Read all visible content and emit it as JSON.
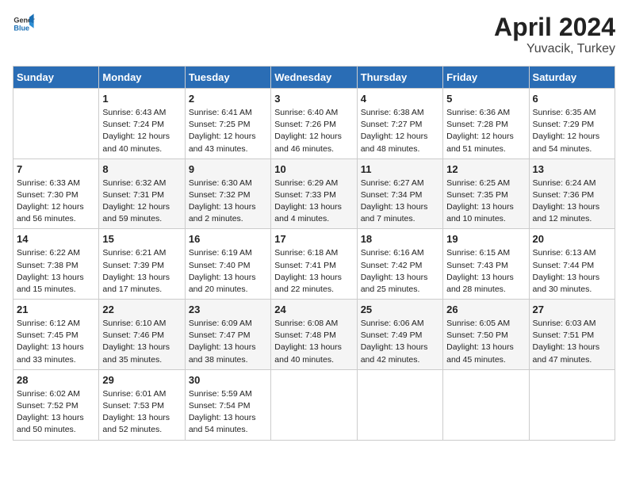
{
  "header": {
    "logo_general": "General",
    "logo_blue": "Blue",
    "title": "April 2024",
    "subtitle": "Yuvacik, Turkey"
  },
  "calendar": {
    "days_of_week": [
      "Sunday",
      "Monday",
      "Tuesday",
      "Wednesday",
      "Thursday",
      "Friday",
      "Saturday"
    ],
    "weeks": [
      [
        {
          "day": "",
          "content": ""
        },
        {
          "day": "1",
          "sunrise": "Sunrise: 6:43 AM",
          "sunset": "Sunset: 7:24 PM",
          "daylight": "Daylight: 12 hours and 40 minutes."
        },
        {
          "day": "2",
          "sunrise": "Sunrise: 6:41 AM",
          "sunset": "Sunset: 7:25 PM",
          "daylight": "Daylight: 12 hours and 43 minutes."
        },
        {
          "day": "3",
          "sunrise": "Sunrise: 6:40 AM",
          "sunset": "Sunset: 7:26 PM",
          "daylight": "Daylight: 12 hours and 46 minutes."
        },
        {
          "day": "4",
          "sunrise": "Sunrise: 6:38 AM",
          "sunset": "Sunset: 7:27 PM",
          "daylight": "Daylight: 12 hours and 48 minutes."
        },
        {
          "day": "5",
          "sunrise": "Sunrise: 6:36 AM",
          "sunset": "Sunset: 7:28 PM",
          "daylight": "Daylight: 12 hours and 51 minutes."
        },
        {
          "day": "6",
          "sunrise": "Sunrise: 6:35 AM",
          "sunset": "Sunset: 7:29 PM",
          "daylight": "Daylight: 12 hours and 54 minutes."
        }
      ],
      [
        {
          "day": "7",
          "sunrise": "Sunrise: 6:33 AM",
          "sunset": "Sunset: 7:30 PM",
          "daylight": "Daylight: 12 hours and 56 minutes."
        },
        {
          "day": "8",
          "sunrise": "Sunrise: 6:32 AM",
          "sunset": "Sunset: 7:31 PM",
          "daylight": "Daylight: 12 hours and 59 minutes."
        },
        {
          "day": "9",
          "sunrise": "Sunrise: 6:30 AM",
          "sunset": "Sunset: 7:32 PM",
          "daylight": "Daylight: 13 hours and 2 minutes."
        },
        {
          "day": "10",
          "sunrise": "Sunrise: 6:29 AM",
          "sunset": "Sunset: 7:33 PM",
          "daylight": "Daylight: 13 hours and 4 minutes."
        },
        {
          "day": "11",
          "sunrise": "Sunrise: 6:27 AM",
          "sunset": "Sunset: 7:34 PM",
          "daylight": "Daylight: 13 hours and 7 minutes."
        },
        {
          "day": "12",
          "sunrise": "Sunrise: 6:25 AM",
          "sunset": "Sunset: 7:35 PM",
          "daylight": "Daylight: 13 hours and 10 minutes."
        },
        {
          "day": "13",
          "sunrise": "Sunrise: 6:24 AM",
          "sunset": "Sunset: 7:36 PM",
          "daylight": "Daylight: 13 hours and 12 minutes."
        }
      ],
      [
        {
          "day": "14",
          "sunrise": "Sunrise: 6:22 AM",
          "sunset": "Sunset: 7:38 PM",
          "daylight": "Daylight: 13 hours and 15 minutes."
        },
        {
          "day": "15",
          "sunrise": "Sunrise: 6:21 AM",
          "sunset": "Sunset: 7:39 PM",
          "daylight": "Daylight: 13 hours and 17 minutes."
        },
        {
          "day": "16",
          "sunrise": "Sunrise: 6:19 AM",
          "sunset": "Sunset: 7:40 PM",
          "daylight": "Daylight: 13 hours and 20 minutes."
        },
        {
          "day": "17",
          "sunrise": "Sunrise: 6:18 AM",
          "sunset": "Sunset: 7:41 PM",
          "daylight": "Daylight: 13 hours and 22 minutes."
        },
        {
          "day": "18",
          "sunrise": "Sunrise: 6:16 AM",
          "sunset": "Sunset: 7:42 PM",
          "daylight": "Daylight: 13 hours and 25 minutes."
        },
        {
          "day": "19",
          "sunrise": "Sunrise: 6:15 AM",
          "sunset": "Sunset: 7:43 PM",
          "daylight": "Daylight: 13 hours and 28 minutes."
        },
        {
          "day": "20",
          "sunrise": "Sunrise: 6:13 AM",
          "sunset": "Sunset: 7:44 PM",
          "daylight": "Daylight: 13 hours and 30 minutes."
        }
      ],
      [
        {
          "day": "21",
          "sunrise": "Sunrise: 6:12 AM",
          "sunset": "Sunset: 7:45 PM",
          "daylight": "Daylight: 13 hours and 33 minutes."
        },
        {
          "day": "22",
          "sunrise": "Sunrise: 6:10 AM",
          "sunset": "Sunset: 7:46 PM",
          "daylight": "Daylight: 13 hours and 35 minutes."
        },
        {
          "day": "23",
          "sunrise": "Sunrise: 6:09 AM",
          "sunset": "Sunset: 7:47 PM",
          "daylight": "Daylight: 13 hours and 38 minutes."
        },
        {
          "day": "24",
          "sunrise": "Sunrise: 6:08 AM",
          "sunset": "Sunset: 7:48 PM",
          "daylight": "Daylight: 13 hours and 40 minutes."
        },
        {
          "day": "25",
          "sunrise": "Sunrise: 6:06 AM",
          "sunset": "Sunset: 7:49 PM",
          "daylight": "Daylight: 13 hours and 42 minutes."
        },
        {
          "day": "26",
          "sunrise": "Sunrise: 6:05 AM",
          "sunset": "Sunset: 7:50 PM",
          "daylight": "Daylight: 13 hours and 45 minutes."
        },
        {
          "day": "27",
          "sunrise": "Sunrise: 6:03 AM",
          "sunset": "Sunset: 7:51 PM",
          "daylight": "Daylight: 13 hours and 47 minutes."
        }
      ],
      [
        {
          "day": "28",
          "sunrise": "Sunrise: 6:02 AM",
          "sunset": "Sunset: 7:52 PM",
          "daylight": "Daylight: 13 hours and 50 minutes."
        },
        {
          "day": "29",
          "sunrise": "Sunrise: 6:01 AM",
          "sunset": "Sunset: 7:53 PM",
          "daylight": "Daylight: 13 hours and 52 minutes."
        },
        {
          "day": "30",
          "sunrise": "Sunrise: 5:59 AM",
          "sunset": "Sunset: 7:54 PM",
          "daylight": "Daylight: 13 hours and 54 minutes."
        },
        {
          "day": "",
          "content": ""
        },
        {
          "day": "",
          "content": ""
        },
        {
          "day": "",
          "content": ""
        },
        {
          "day": "",
          "content": ""
        }
      ]
    ]
  }
}
